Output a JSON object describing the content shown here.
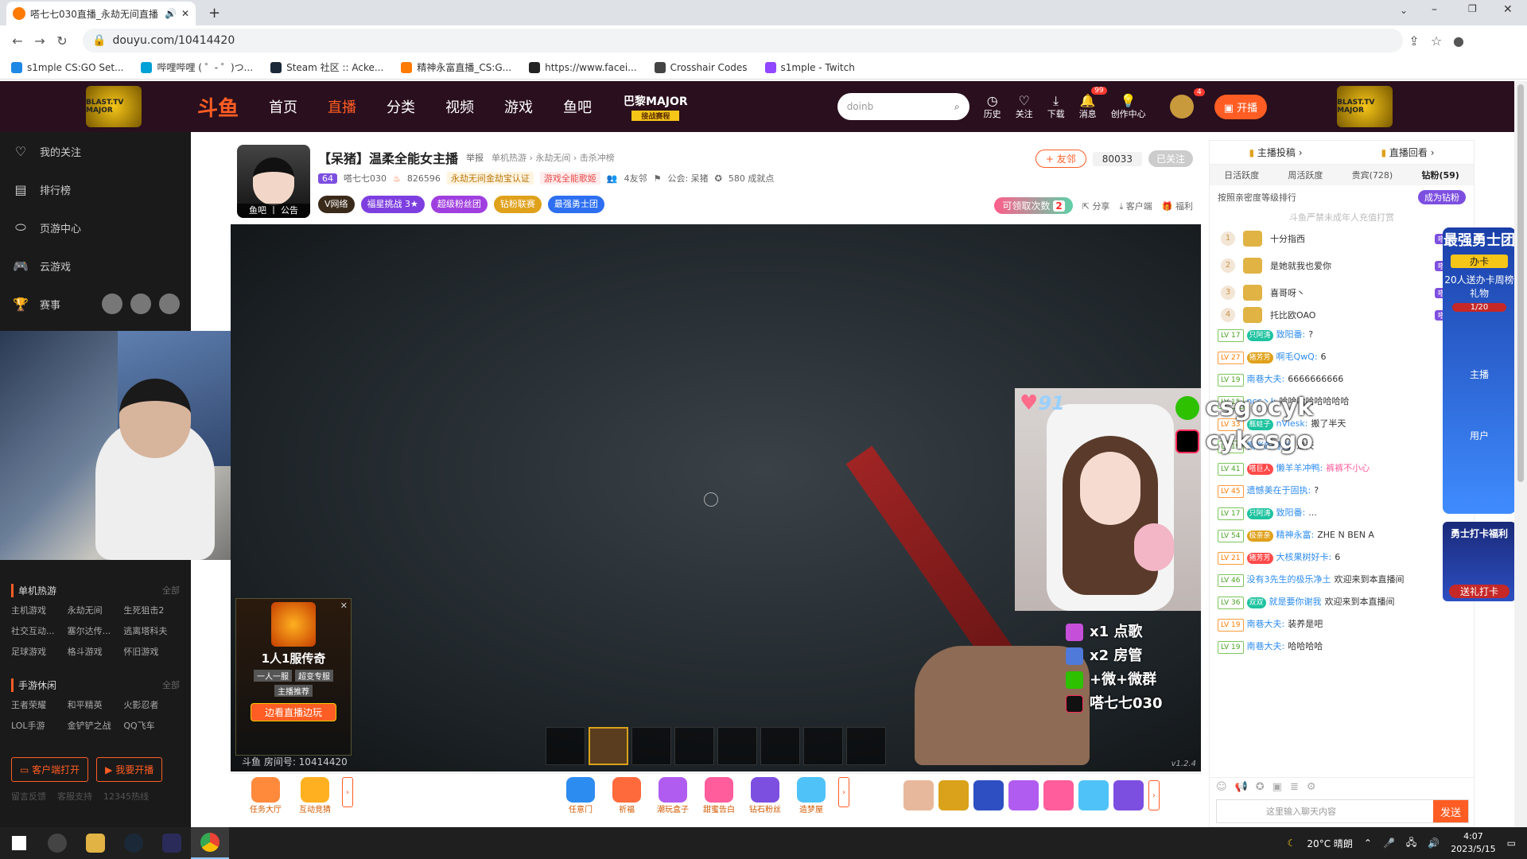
{
  "browser": {
    "tab_title": "嗒七七030直播_永劫无间直播",
    "url": "douyu.com/10414420",
    "bookmarks": [
      "s1mple CS:GO Set...",
      "哔哩哔哩 ( ゜- ゜)つ...",
      "Steam 社区 :: Acke...",
      "精神永富直播_CS:G...",
      "https://www.facei...",
      "Crosshair Codes",
      "s1mple - Twitch"
    ],
    "bookmark_colors": [
      "#1e88e5",
      "#00a1d6",
      "#1b2838",
      "#ff7a00",
      "#222222",
      "#444444",
      "#9146ff"
    ]
  },
  "header": {
    "blast_label": "BLAST.TV MAJOR",
    "logo": "斗鱼",
    "nav": [
      "首页",
      "直播",
      "分类",
      "视频",
      "游戏",
      "鱼吧"
    ],
    "major": "巴黎MAJOR",
    "major_tag": "接战赛程",
    "search_placeholder": "doinb",
    "icons": [
      {
        "label": "历史",
        "icon": "clock-icon"
      },
      {
        "label": "关注",
        "icon": "heart-icon"
      },
      {
        "label": "下载",
        "icon": "download-icon"
      },
      {
        "label": "消息",
        "icon": "bell-icon",
        "badge": "99"
      },
      {
        "label": "创作中心",
        "icon": "bulb-icon"
      }
    ],
    "avatar_badge": "4",
    "start_live": "开播",
    "accent": "#ff5d23"
  },
  "sidebar": {
    "items": [
      {
        "label": "我的关注",
        "icon": "heart-icon"
      },
      {
        "label": "排行榜",
        "icon": "rank-icon"
      },
      {
        "label": "页游中心",
        "icon": "game-icon"
      },
      {
        "label": "云游戏",
        "icon": "gamepad-icon"
      },
      {
        "label": "赛事",
        "icon": "trophy-icon"
      }
    ],
    "group1": {
      "title": "单机热游",
      "all": "全部",
      "items": [
        "主机游戏",
        "永劫无间",
        "生死狙击2",
        "社交互动...",
        "塞尔达传...",
        "逃离塔科夫",
        "足球游戏",
        "格斗游戏",
        "怀旧游戏"
      ]
    },
    "group2": {
      "title": "手游休闲",
      "all": "全部",
      "items": [
        "王者荣耀",
        "和平精英",
        "火影忍者",
        "LOL手游",
        "金铲铲之战",
        "QQ飞车"
      ]
    },
    "client_btn": "客户端打开",
    "live_btn": "我要开播",
    "links": [
      "留言反馈",
      "客服支持",
      "12345热线"
    ]
  },
  "room": {
    "avatar_caption": "鱼吧 丨 公告",
    "title": "【呆猪】温柔全能女主播",
    "report": "举报",
    "breadcrumb": "单机热游 › 永劫无间 › 击杀冲榜",
    "level": "64",
    "anchor": "嗒七七030",
    "hot": "826596",
    "tag1": "永劫无间金劫宝认证",
    "tag2": "游戏全能歌姬",
    "friends": "4友邻",
    "guild": "公会: 呆猪",
    "ready": "580 成就点",
    "pills": [
      {
        "label": "V网络",
        "color": "#3a2a1a"
      },
      {
        "label": "福星挑战 3★",
        "color": "#7d3fe0"
      },
      {
        "label": "超级粉丝团",
        "color": "#a03fe0"
      },
      {
        "label": "钻粉联赛",
        "color": "#e0a11b"
      },
      {
        "label": "最强勇士团",
        "color": "#2d6ff0"
      }
    ],
    "friend_btn": "+ 友邻",
    "follow_count": "80033",
    "followed": "已关注",
    "lq_label": "可领取次数",
    "lq_count": "2",
    "actions": [
      "分享",
      "客户端",
      "福利"
    ]
  },
  "video": {
    "room_id": "斗鱼 房间号: 10414420",
    "version": "v1.2.4",
    "hearts": "91",
    "perks": [
      {
        "text": "x1 点歌",
        "icon": "song-icon"
      },
      {
        "text": "x2 房管",
        "icon": "admin-icon"
      },
      {
        "text": "+微+微群",
        "icon": "wechat-icon"
      },
      {
        "text": "嗒七七030",
        "icon": "tiktok-icon"
      }
    ],
    "hotbar_slots": 8
  },
  "ad": {
    "title": "1人1服传奇",
    "tags": [
      "一人一服",
      "超变专服"
    ],
    "sub": "主播推荐",
    "button": "边看直播边玩"
  },
  "gifts": {
    "left": [
      {
        "label": "任务大厅",
        "color": "#ff8a3c"
      },
      {
        "label": "互动竞猜",
        "color": "#ffb020"
      }
    ],
    "mid": [
      {
        "label": "任意门",
        "color": "#2d8cf0"
      },
      {
        "label": "祈福",
        "color": "#ff6a3c"
      },
      {
        "label": "潮玩盒子",
        "color": "#b05cf0"
      },
      {
        "label": "甜蜜告白",
        "color": "#ff5d9c"
      },
      {
        "label": "钻石粉丝",
        "color": "#7d4fe0"
      },
      {
        "label": "造梦屋",
        "color": "#4fc3f7"
      }
    ],
    "right_colors": [
      "#e8b89c",
      "#d9a21a",
      "#2d4fc2",
      "#b05cf0",
      "#ff5d9c",
      "#4fc3f7",
      "#7d4fe0"
    ]
  },
  "chat": {
    "top": [
      "主播投稿",
      "直播回看"
    ],
    "tabs": [
      "日活跃度",
      "周活跃度",
      "贵宾(728)",
      "钻粉(59)"
    ],
    "rank_label": "按照亲密度等级排行",
    "fans_btn": "成为钻粉",
    "notice": "斗鱼严禁未成年人充值打赏",
    "ranking": [
      {
        "n": "1",
        "name": "十分指西",
        "badge": "嗒巨人"
      },
      {
        "n": "2",
        "name": "是她就我也爱你",
        "badge": "嗒巨人"
      },
      {
        "n": "3",
        "name": "喜哥呀丶",
        "badge": "嗒巨人"
      },
      {
        "n": "4",
        "name": "托比欧OAO",
        "badge": "嗒巨人"
      }
    ],
    "messages": [
      {
        "lv": "LV 17",
        "badge": "只阿涛",
        "name": "致阳番:",
        "text": "?"
      },
      {
        "lv": "LV 27",
        "badge": "猪芳芳",
        "name": "啊毛QwQ:",
        "text": "6"
      },
      {
        "lv": "LV 19",
        "badge": "",
        "name": "南巷大夫:",
        "text": "6666666666"
      },
      {
        "lv": "LV 15",
        "badge": "",
        "name": "ncc丶J:",
        "text": "哈哈哈哈哈哈哈哈"
      },
      {
        "lv": "LV 33",
        "badge": "瓶蛀子",
        "name": "nViesk:",
        "text": "搬了半天"
      },
      {
        "lv": "LV 19",
        "badge": "",
        "name": "惆怅的月光:",
        "text": "逆天"
      },
      {
        "lv": "LV 41",
        "badge": "嗒巨人",
        "name": "懒羊羊冲鸭:",
        "text": "裤裤不小心"
      },
      {
        "lv": "LV 45",
        "badge": "",
        "name": "遗憾美在于固执:",
        "text": "?"
      },
      {
        "lv": "LV 17",
        "badge": "只阿涛",
        "name": "致阳番:",
        "text": "..."
      },
      {
        "lv": "LV 54",
        "badge": "极亲亲",
        "name": "精神永富:",
        "text": "ZHE N BEN A"
      },
      {
        "lv": "LV 21",
        "badge": "猪芳芳",
        "name": "大核果树好卡:",
        "text": "6"
      },
      {
        "lv": "LV 46",
        "badge": "",
        "name": "没有3先生的极乐净土",
        "text": "欢迎来到本直播间"
      },
      {
        "lv": "LV 36",
        "badge": "双双",
        "name": "就是要你谢我",
        "text": "欢迎来到本直播间"
      },
      {
        "lv": "LV 19",
        "badge": "",
        "name": "南巷大夫:",
        "text": "装养是吧"
      },
      {
        "lv": "LV 19",
        "badge": "",
        "name": "南巷大夫:",
        "text": "哈哈哈哈"
      }
    ],
    "input_placeholder": "这里输入聊天内容",
    "send": "发送"
  },
  "sticker": {
    "line1": "csgocyk",
    "line2": "cykcsgo"
  },
  "fighter": {
    "title": "最强勇士团",
    "card": "办卡",
    "desc": "20人送办卡周榜礼物",
    "progress": "1/20",
    "role1": "主播",
    "role2": "用户",
    "bottom_title": "勇士打卡福利",
    "bottom_btn": "送礼打卡"
  },
  "taskbar": {
    "weather": "20°C 晴朗",
    "time": "4:07",
    "date": "2023/5/15"
  }
}
